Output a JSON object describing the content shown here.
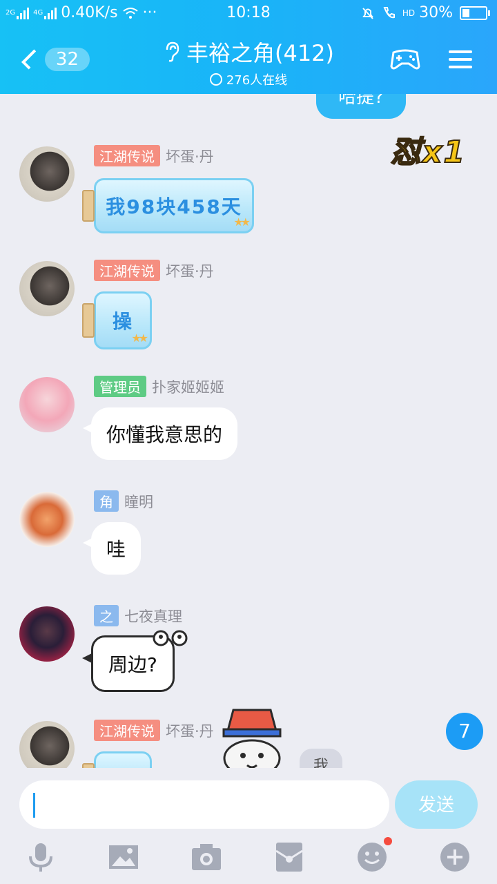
{
  "status_bar": {
    "net_small_1": "2G",
    "net_small_2": "4G",
    "speed": "0.40K/s",
    "dots": "···",
    "time": "10:18",
    "hd": "HD",
    "battery": "30%",
    "battery_fraction": 0.3
  },
  "header": {
    "back_count": "32",
    "group_name": "丰裕之角(412)",
    "online": "276人在线"
  },
  "chat": {
    "partial_bubble_text": "哈提?",
    "badge_text": "怼x1",
    "messages": [
      {
        "tag": "江湖传说",
        "name": "坏蛋·丹",
        "text": "我98块458天"
      },
      {
        "tag": "江湖传说",
        "name": "坏蛋·丹",
        "text": "操"
      },
      {
        "tag": "管理员",
        "name": "扑家姬姬姬",
        "text": "你懂我意思的"
      },
      {
        "tag": "角",
        "name": "瞳明",
        "text": "哇"
      },
      {
        "tag": "之",
        "name": "七夜真理",
        "text": "周边?"
      },
      {
        "tag": "江湖传说",
        "name": "坏蛋·丹",
        "text": ""
      }
    ],
    "my_bubble": "我",
    "unread_count": "7"
  },
  "input": {
    "placeholder": "",
    "send_label": "发送"
  },
  "toolbar": {
    "icons": [
      "microphone-icon",
      "image-icon",
      "camera-icon",
      "red-packet-icon",
      "emoji-icon",
      "plus-icon"
    ]
  },
  "colors": {
    "header": "#19B4F8",
    "accent": "#1C9CF5",
    "tag_red": "#F58E80",
    "tag_green": "#5ECB84",
    "tag_blue": "#8BB9EE"
  }
}
